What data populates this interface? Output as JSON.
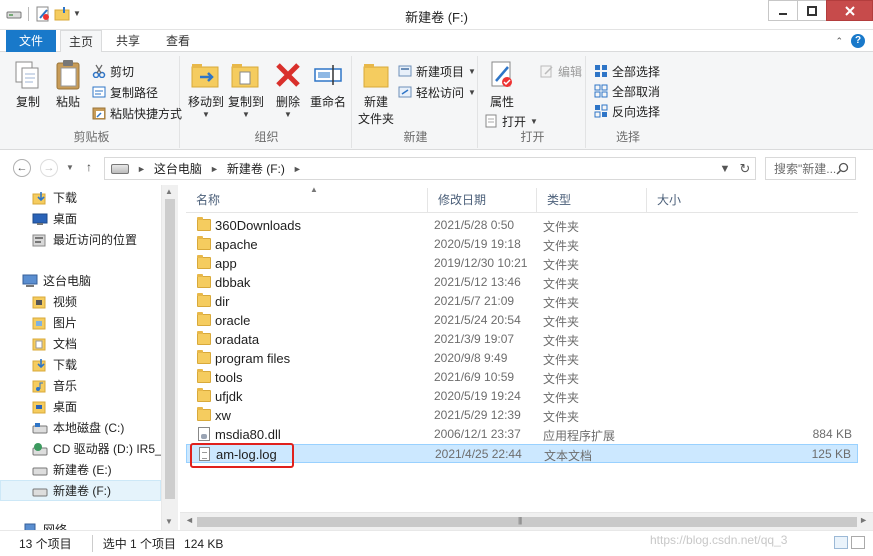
{
  "window": {
    "title": "新建卷 (F:)"
  },
  "ribbon_tabs": [
    {
      "label": "文件"
    },
    {
      "label": "主页"
    },
    {
      "label": "共享"
    },
    {
      "label": "查看"
    }
  ],
  "ribbon": {
    "clipboard": {
      "label": "剪贴板",
      "copy": "复制",
      "paste": "粘贴",
      "cut": "剪切",
      "copy_path": "复制路径",
      "paste_shortcut": "粘贴快捷方式"
    },
    "organize": {
      "label": "组织",
      "move_to": "移动到",
      "copy_to": "复制到",
      "delete": "删除",
      "rename": "重命名"
    },
    "new": {
      "label": "新建",
      "new_folder_line1": "新建",
      "new_folder_line2": "文件夹",
      "new_item": "新建项目",
      "easy_access": "轻松访问"
    },
    "open": {
      "label": "打开",
      "properties": "属性",
      "open": "打开",
      "edit": "编辑"
    },
    "select": {
      "label": "选择",
      "select_all": "全部选择",
      "select_none": "全部取消",
      "invert": "反向选择"
    }
  },
  "address": {
    "crumbs": [
      "这台电脑",
      "新建卷 (F:)"
    ],
    "search_placeholder": "搜索\"新建..."
  },
  "sidebar": {
    "items": [
      {
        "label": "下载",
        "icon": "download-folder-icon"
      },
      {
        "label": "桌面",
        "icon": "desktop-icon"
      },
      {
        "label": "最近访问的位置",
        "icon": "recent-places-icon"
      },
      {
        "label": "这台电脑",
        "icon": "computer-icon"
      },
      {
        "label": "视频",
        "icon": "videos-folder-icon"
      },
      {
        "label": "图片",
        "icon": "pictures-folder-icon"
      },
      {
        "label": "文档",
        "icon": "documents-folder-icon"
      },
      {
        "label": "下载",
        "icon": "download-folder-icon"
      },
      {
        "label": "音乐",
        "icon": "music-folder-icon"
      },
      {
        "label": "桌面",
        "icon": "desktop-folder-icon"
      },
      {
        "label": "本地磁盘 (C:)",
        "icon": "local-disk-icon"
      },
      {
        "label": "CD 驱动器 (D:) IR5_SS",
        "icon": "cd-drive-icon"
      },
      {
        "label": "新建卷 (E:)",
        "icon": "drive-icon"
      },
      {
        "label": "新建卷 (F:)",
        "icon": "drive-icon"
      },
      {
        "label": "网络",
        "icon": "network-icon"
      }
    ]
  },
  "columns": {
    "name": "名称",
    "date": "修改日期",
    "type": "类型",
    "size": "大小"
  },
  "files": [
    {
      "name": "360Downloads",
      "date": "2021/5/28 0:50",
      "type": "文件夹",
      "size": "",
      "kind": "folder"
    },
    {
      "name": "apache",
      "date": "2020/5/19 19:18",
      "type": "文件夹",
      "size": "",
      "kind": "folder"
    },
    {
      "name": "app",
      "date": "2019/12/30 10:21",
      "type": "文件夹",
      "size": "",
      "kind": "folder"
    },
    {
      "name": "dbbak",
      "date": "2021/5/12 13:46",
      "type": "文件夹",
      "size": "",
      "kind": "folder"
    },
    {
      "name": "dir",
      "date": "2021/5/7 21:09",
      "type": "文件夹",
      "size": "",
      "kind": "folder"
    },
    {
      "name": "oracle",
      "date": "2021/5/24 20:54",
      "type": "文件夹",
      "size": "",
      "kind": "folder"
    },
    {
      "name": "oradata",
      "date": "2021/3/9 19:07",
      "type": "文件夹",
      "size": "",
      "kind": "folder"
    },
    {
      "name": "program files",
      "date": "2020/9/8 9:49",
      "type": "文件夹",
      "size": "",
      "kind": "folder"
    },
    {
      "name": "tools",
      "date": "2021/6/9 10:59",
      "type": "文件夹",
      "size": "",
      "kind": "folder"
    },
    {
      "name": "ufjdk",
      "date": "2020/5/19 19:24",
      "type": "文件夹",
      "size": "",
      "kind": "folder"
    },
    {
      "name": "xw",
      "date": "2021/5/29 12:39",
      "type": "文件夹",
      "size": "",
      "kind": "folder"
    },
    {
      "name": "msdia80.dll",
      "date": "2006/12/1 23:37",
      "type": "应用程序扩展",
      "size": "884 KB",
      "kind": "dll"
    },
    {
      "name": "am-log.log",
      "date": "2021/4/25 22:44",
      "type": "文本文档",
      "size": "125 KB",
      "kind": "doc",
      "selected": true
    }
  ],
  "status": {
    "count": "13 个项目",
    "selection": "选中 1 个项目",
    "size": "124 KB"
  },
  "watermark": "https://blog.csdn.net/qq_3",
  "colors": {
    "accent": "#1979ca",
    "selection": "#cce8ff",
    "highlight_box": "#e0211d"
  }
}
